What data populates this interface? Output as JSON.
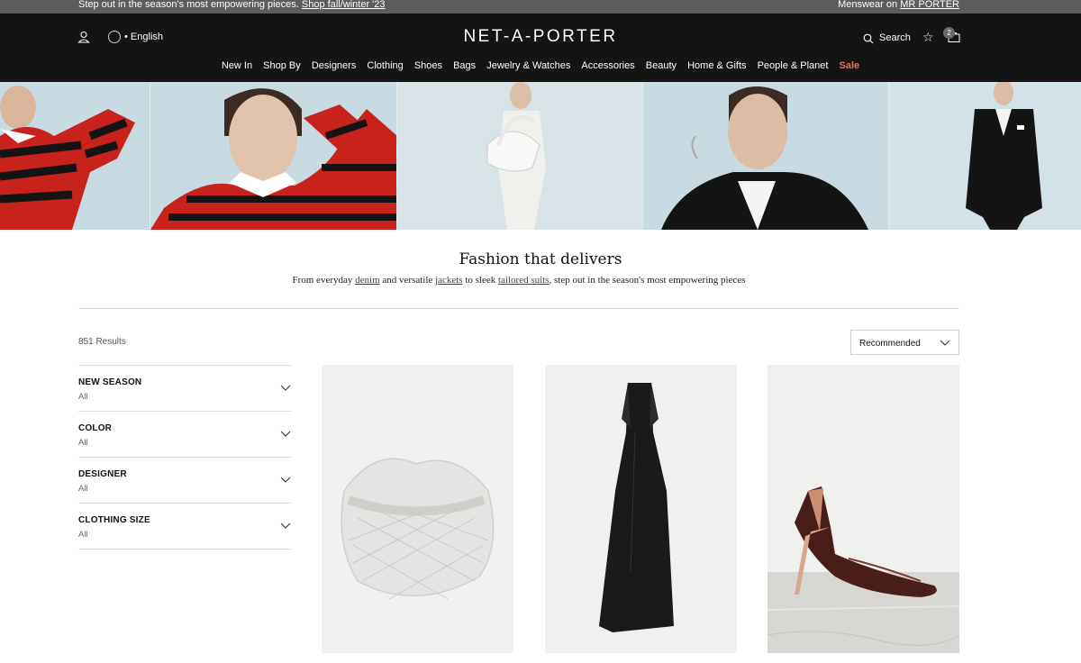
{
  "promo": {
    "left_text": "Step out in the season's most empowering pieces.",
    "left_link": "Shop fall/winter '23",
    "right_text": "Menswear on",
    "right_link": "MR PORTER"
  },
  "header": {
    "logo": "NET-A-PORTER",
    "language": "English",
    "search_label": "Search",
    "bag_count": "2"
  },
  "nav": {
    "items": [
      "New In",
      "Shop By",
      "Designers",
      "Clothing",
      "Shoes",
      "Bags",
      "Jewelry & Watches",
      "Accessories",
      "Beauty",
      "Home & Gifts",
      "People & Planet"
    ],
    "sale": "Sale"
  },
  "hero": {
    "colors": {
      "red": "#c8221d",
      "black": "#141414",
      "sky": "#c9dbe2"
    }
  },
  "intro": {
    "title": "Fashion that delivers",
    "sub_1": "From everyday ",
    "link_denim": "denim",
    "sub_2": " and versatile ",
    "link_jackets": "jackets",
    "sub_3": " to sleek ",
    "link_suits": "tailored suits",
    "sub_4": ", step out in the season's most empowering pieces"
  },
  "listing": {
    "results": "851 Results",
    "sort": "Recommended"
  },
  "filters": [
    {
      "heading": "NEW SEASON",
      "value": "All"
    },
    {
      "heading": "COLOR",
      "value": "All"
    },
    {
      "heading": "DESIGNER",
      "value": "All"
    },
    {
      "heading": "CLOTHING SIZE",
      "value": "All"
    }
  ],
  "products": [
    {
      "kind": "woven-leather-bag",
      "color": "#e4e4e2"
    },
    {
      "kind": "black-halter-gown",
      "color": "#1a1a1a"
    },
    {
      "kind": "patent-slingback-pump",
      "color": "#4a1e18"
    }
  ]
}
